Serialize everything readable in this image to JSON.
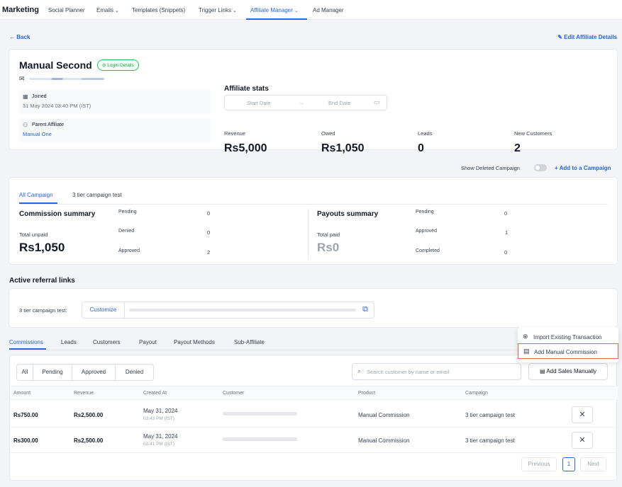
{
  "nav": {
    "brand": "Marketing",
    "items": [
      {
        "label": "Social Planner",
        "chevron": false
      },
      {
        "label": "Emails",
        "chevron": true
      },
      {
        "label": "Templates (Snippets)",
        "chevron": false
      },
      {
        "label": "Trigger Links",
        "chevron": true
      },
      {
        "label": "Affiliate Manager",
        "chevron": true
      },
      {
        "label": "Ad Manager",
        "chevron": false
      }
    ],
    "chevron_glyph": "⌄"
  },
  "back_label": "Back",
  "edit_label": "Edit Affiliate Details",
  "profile": {
    "name": "Manual Second",
    "login_badge": "Login Details",
    "joined_label": "Joined",
    "joined_value": "31 May 2024 03:40 PM (IST)",
    "parent_label": "Parent Affiliate",
    "parent_value": "Manual One"
  },
  "stats": {
    "title": "Affiliate stats",
    "start_placeholder": "Start Date",
    "end_placeholder": "End Date",
    "items": [
      {
        "label": "Revenue",
        "value": "Rs5,000"
      },
      {
        "label": "Owed",
        "value": "Rs1,050"
      },
      {
        "label": "Leads",
        "value": "0"
      },
      {
        "label": "New Customers",
        "value": "2"
      }
    ]
  },
  "campaign_bar": {
    "show_deleted": "Show Deleted Campaign",
    "add_campaign": "Add to a Campaign"
  },
  "campaign_tabs": [
    "All Campaign",
    "3 tier campaign test"
  ],
  "commission_summary": {
    "title": "Commission summary",
    "sub": "Total unpaid",
    "value": "Rs1,050",
    "rows": [
      {
        "k": "Pending",
        "v": "0"
      },
      {
        "k": "Denied",
        "v": "0"
      },
      {
        "k": "Approved",
        "v": "2"
      }
    ]
  },
  "payouts_summary": {
    "title": "Payouts summary",
    "sub": "Total paid",
    "value": "Rs0",
    "rows": [
      {
        "k": "Pending",
        "v": "0"
      },
      {
        "k": "Approved",
        "v": "1"
      },
      {
        "k": "Completed",
        "v": "0"
      }
    ]
  },
  "referral": {
    "title": "Active referral links",
    "label": "3 tier campaign test:",
    "customize": "Customize"
  },
  "bottom_tabs": [
    "Commissions",
    "Leads",
    "Customers",
    "Payout",
    "Payout Methods",
    "Sub-Affiliate"
  ],
  "dropdown": [
    "Import Existing Transaction",
    "Add Manual Commission"
  ],
  "filters": [
    "All",
    "Pending",
    "Approved",
    "Denied"
  ],
  "search_placeholder": "Search customer by name or email",
  "add_sales": "Add Sales Manually",
  "table": {
    "headers": [
      "Amount",
      "Revenue",
      "Created At",
      "Customer",
      "Product",
      "Campaign"
    ],
    "rows": [
      {
        "amount": "Rs750.00",
        "revenue": "Rs2,500.00",
        "date": "May 31, 2024",
        "time": "03:43 PM (IST)",
        "product": "Manual Commission",
        "campaign": "3 tier campaign test"
      },
      {
        "amount": "Rs300.00",
        "revenue": "Rs2,500.00",
        "date": "May 31, 2024",
        "time": "03:41 PM (IST)",
        "product": "Manual Commission",
        "campaign": "3 tier campaign test"
      }
    ]
  },
  "pagination": {
    "previous": "Previous",
    "current": "1",
    "next": "Next"
  },
  "colors": {
    "accent": "#2563eb",
    "highlight": "#e8674d",
    "success": "#16a34a"
  }
}
